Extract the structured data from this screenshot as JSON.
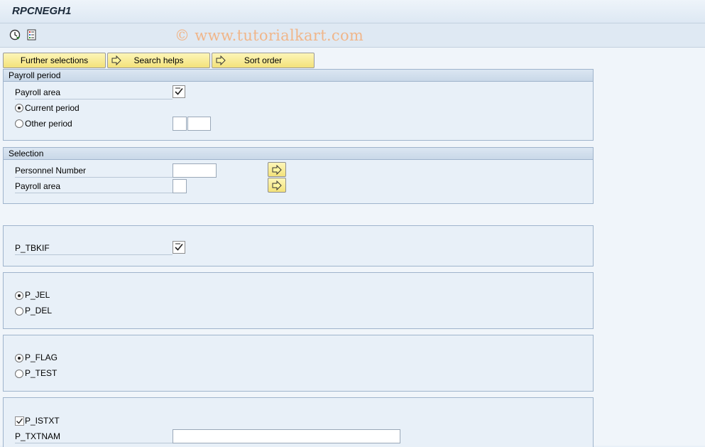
{
  "window": {
    "title": "RPCNEGH1"
  },
  "toolbar": {
    "icons": [
      "execute-icon",
      "variant-icon"
    ],
    "watermark": "© www.tutorialkart.com"
  },
  "action_buttons": {
    "further_selections": "Further selections",
    "search_helps": "Search helps",
    "sort_order": "Sort order"
  },
  "payroll_period": {
    "title": "Payroll period",
    "payroll_area_label": "Payroll area",
    "payroll_area_checked": true,
    "current_period_label": "Current period",
    "current_period_selected": true,
    "other_period_label": "Other period",
    "other_period_value1": "",
    "other_period_value2": ""
  },
  "selection": {
    "title": "Selection",
    "personnel_number_label": "Personnel Number",
    "personnel_number_value": "",
    "payroll_area_label": "Payroll area",
    "payroll_area_value": ""
  },
  "p_tbkif": {
    "label": "P_TBKIF",
    "checked": true
  },
  "jel_group": {
    "p_jel_label": "P_JEL",
    "p_jel_selected": true,
    "p_del_label": "P_DEL",
    "p_del_selected": false
  },
  "flag_group": {
    "p_flag_label": "P_FLAG",
    "p_flag_selected": true,
    "p_test_label": "P_TEST",
    "p_test_selected": false
  },
  "txt_group": {
    "p_istxt_label": "P_ISTXT",
    "p_istxt_checked": true,
    "p_txtnam_label": "P_TXTNAM",
    "p_txtnam_value": ""
  }
}
